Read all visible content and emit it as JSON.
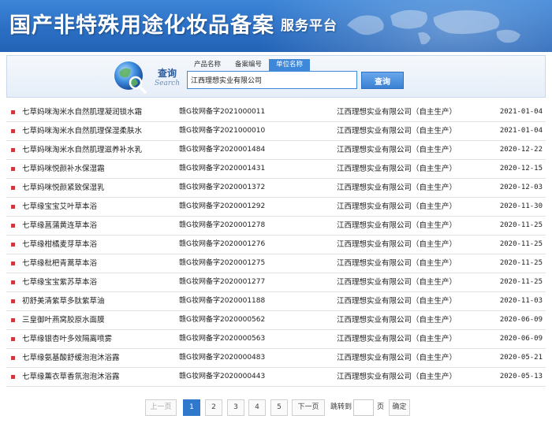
{
  "header": {
    "title": "国产非特殊用途化妆品备案",
    "subtitle": "服务平台"
  },
  "search": {
    "label_cn": "查询",
    "label_en": "Search",
    "tabs": [
      {
        "label": "产品名称",
        "active": false
      },
      {
        "label": "备案编号",
        "active": false
      },
      {
        "label": "单位名称",
        "active": true
      }
    ],
    "value": "江西理想实业有限公司",
    "button_label": "查询"
  },
  "results": [
    {
      "name": "七草妈咪淘米水自然肌理凝润锁水霜",
      "code": "赣G妆网备字2021000011",
      "company": "江西理想实业有限公司（自主生产）",
      "date": "2021-01-04"
    },
    {
      "name": "七草妈咪淘米水自然肌理保湿柔肤水",
      "code": "赣G妆网备字2021000010",
      "company": "江西理想实业有限公司（自主生产）",
      "date": "2021-01-04"
    },
    {
      "name": "七草妈咪淘米水自然肌理滋养补水乳",
      "code": "赣G妆网备字2020001484",
      "company": "江西理想实业有限公司（自主生产）",
      "date": "2020-12-22"
    },
    {
      "name": "七草妈咪悦颜补水保湿霜",
      "code": "赣G妆网备字2020001431",
      "company": "江西理想实业有限公司（自主生产）",
      "date": "2020-12-15"
    },
    {
      "name": "七草妈咪悦颜紧致保湿乳",
      "code": "赣G妆网备字2020001372",
      "company": "江西理想实业有限公司（自主生产）",
      "date": "2020-12-03"
    },
    {
      "name": "七草缘宝宝艾叶草本浴",
      "code": "赣G妆网备字2020001292",
      "company": "江西理想实业有限公司（自主生产）",
      "date": "2020-11-30"
    },
    {
      "name": "七草缘菖蒲黄连草本浴",
      "code": "赣G妆网备字2020001278",
      "company": "江西理想实业有限公司（自主生产）",
      "date": "2020-11-25"
    },
    {
      "name": "七草缘柑橘麦芽草本浴",
      "code": "赣G妆网备字2020001276",
      "company": "江西理想实业有限公司（自主生产）",
      "date": "2020-11-25"
    },
    {
      "name": "七草缘枇杷青蒿草本浴",
      "code": "赣G妆网备字2020001275",
      "company": "江西理想实业有限公司（自主生产）",
      "date": "2020-11-25"
    },
    {
      "name": "七草缘宝宝紫苏草本浴",
      "code": "赣G妆网备字2020001277",
      "company": "江西理想实业有限公司（自主生产）",
      "date": "2020-11-25"
    },
    {
      "name": "初舒美清紫草多肽紫草油",
      "code": "赣G妆网备字2020001188",
      "company": "江西理想实业有限公司（自主生产）",
      "date": "2020-11-03"
    },
    {
      "name": "三皇御叶燕窝胶原水面膜",
      "code": "赣G妆网备字2020000562",
      "company": "江西理想实业有限公司（自主生产）",
      "date": "2020-06-09"
    },
    {
      "name": "七草缘银杏叶多效隔离喷雾",
      "code": "赣G妆网备字2020000563",
      "company": "江西理想实业有限公司（自主生产）",
      "date": "2020-06-09"
    },
    {
      "name": "七草缘氨基酸舒缓泡泡沐浴露",
      "code": "赣G妆网备字2020000483",
      "company": "江西理想实业有限公司（自主生产）",
      "date": "2020-05-21"
    },
    {
      "name": "七草缘薰衣草香氛泡泡沐浴露",
      "code": "赣G妆网备字2020000443",
      "company": "江西理想实业有限公司（自主生产）",
      "date": "2020-05-13"
    }
  ],
  "pagination": {
    "prev": "上一页",
    "pages": [
      "1",
      "2",
      "3",
      "4",
      "5"
    ],
    "current": "1",
    "next": "下一页",
    "jump_label": "跳转到",
    "page_unit": "页",
    "confirm": "确定"
  },
  "colors": {
    "banner": "#2b6fc4",
    "accent": "#3f88d9",
    "bullet": "#d2373b"
  }
}
